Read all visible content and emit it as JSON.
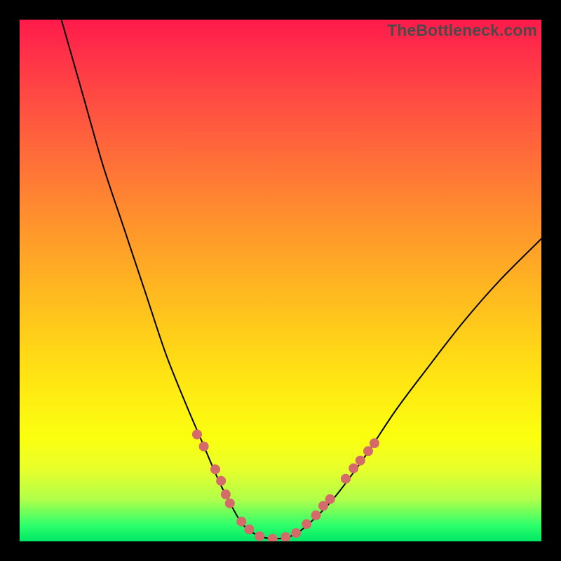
{
  "watermark": "TheBottleneck.com",
  "chart_data": {
    "type": "line",
    "title": "",
    "xlabel": "",
    "ylabel": "",
    "xlim": [
      0,
      100
    ],
    "ylim": [
      0,
      100
    ],
    "series": [
      {
        "name": "bottleneck-curve",
        "x": [
          8,
          12,
          16,
          20,
          24,
          28,
          32,
          35,
          38,
          40.5,
          43,
          46,
          49,
          52,
          55,
          60,
          66,
          72,
          78,
          85,
          92,
          100
        ],
        "y": [
          100,
          86,
          72,
          60,
          48,
          36,
          26,
          19,
          12,
          7,
          3,
          1,
          0.5,
          1,
          3,
          8,
          16,
          25,
          33,
          42,
          50,
          58
        ]
      }
    ],
    "markers": {
      "name": "highlight-dots",
      "color": "#d46a6a",
      "points": [
        {
          "x": 34.0,
          "y": 20.5
        },
        {
          "x": 35.3,
          "y": 18.2
        },
        {
          "x": 37.5,
          "y": 13.8
        },
        {
          "x": 38.6,
          "y": 11.6
        },
        {
          "x": 39.5,
          "y": 9.0
        },
        {
          "x": 40.3,
          "y": 7.3
        },
        {
          "x": 42.5,
          "y": 3.8
        },
        {
          "x": 44.0,
          "y": 2.3
        },
        {
          "x": 46.0,
          "y": 1.0
        },
        {
          "x": 48.5,
          "y": 0.5
        },
        {
          "x": 51.0,
          "y": 0.8
        },
        {
          "x": 53.0,
          "y": 1.6
        },
        {
          "x": 55.0,
          "y": 3.3
        },
        {
          "x": 56.8,
          "y": 5.0
        },
        {
          "x": 58.2,
          "y": 6.8
        },
        {
          "x": 59.5,
          "y": 8.1
        },
        {
          "x": 62.5,
          "y": 12.0
        },
        {
          "x": 64.0,
          "y": 14.0
        },
        {
          "x": 65.3,
          "y": 15.5
        },
        {
          "x": 66.8,
          "y": 17.3
        },
        {
          "x": 68.0,
          "y": 18.8
        }
      ]
    }
  }
}
